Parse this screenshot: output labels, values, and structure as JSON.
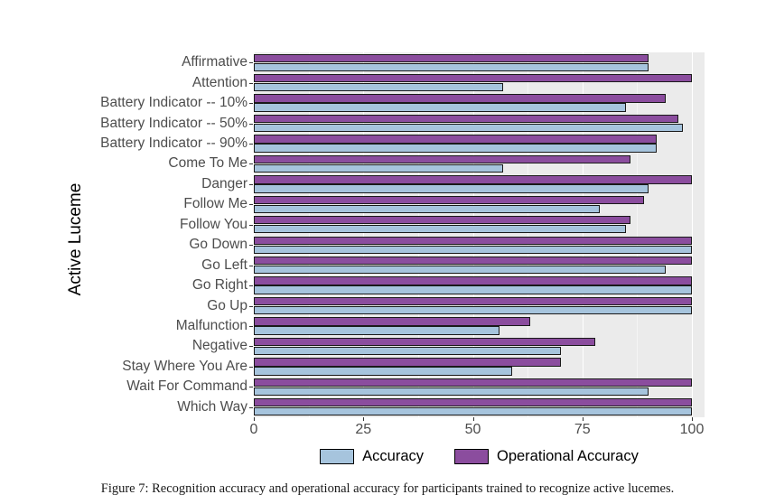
{
  "figure": {
    "caption": "Figure 7: Recognition accuracy and operational accuracy for participants trained to recognize active lucemes."
  },
  "axes": {
    "y_title": "Active Luceme",
    "x_ticks": [
      "0",
      "25",
      "50",
      "75",
      "100"
    ]
  },
  "legend": {
    "items": [
      {
        "label": "Accuracy",
        "color": "#a6c4dd"
      },
      {
        "label": "Operational Accuracy",
        "color": "#8b4d9e"
      }
    ]
  },
  "chart_data": {
    "type": "bar",
    "orientation": "horizontal",
    "title": "",
    "xlabel": "",
    "ylabel": "Active Luceme",
    "xlim": [
      0,
      100
    ],
    "xticks": [
      0,
      25,
      50,
      75,
      100
    ],
    "grid": true,
    "legend_position": "bottom",
    "categories": [
      "Affirmative",
      "Attention",
      "Battery Indicator -- 10%",
      "Battery Indicator -- 50%",
      "Battery Indicator -- 90%",
      "Come To Me",
      "Danger",
      "Follow Me",
      "Follow You",
      "Go Down",
      "Go Left",
      "Go Right",
      "Go Up",
      "Malfunction",
      "Negative",
      "Stay Where You Are",
      "Wait For Command",
      "Which Way"
    ],
    "series": [
      {
        "name": "Accuracy",
        "color": "#a6c4dd",
        "values": [
          90,
          57,
          85,
          98,
          92,
          57,
          90,
          79,
          85,
          100,
          94,
          100,
          100,
          56,
          70,
          59,
          90,
          100
        ]
      },
      {
        "name": "Operational Accuracy",
        "color": "#8b4d9e",
        "values": [
          90,
          100,
          94,
          97,
          92,
          86,
          100,
          89,
          86,
          100,
          100,
          100,
          100,
          63,
          78,
          70,
          100,
          100
        ]
      }
    ]
  }
}
